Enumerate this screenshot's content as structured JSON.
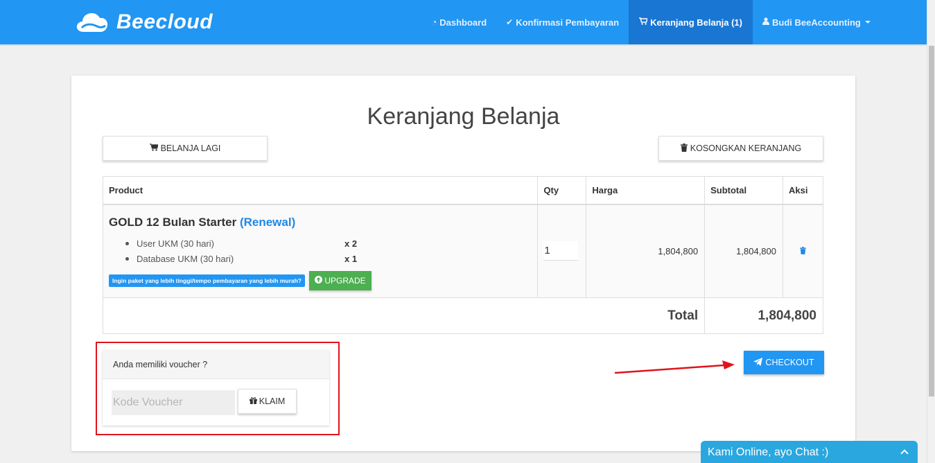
{
  "brand": {
    "name": "Beecloud"
  },
  "nav": {
    "items": [
      {
        "icon": "dashboard-icon",
        "label": "Dashboard"
      },
      {
        "icon": "check-icon",
        "label": "Konfirmasi Pembayaran"
      },
      {
        "icon": "cart-icon",
        "label": "Keranjang Belanja (1)",
        "active": true
      },
      {
        "icon": "user-icon",
        "label": "Budi BeeAccounting"
      }
    ]
  },
  "page": {
    "title": "Keranjang Belanja",
    "continue_label": "BELANJA LAGI",
    "empty_cart_label": "KOSONGKAN KERANJANG"
  },
  "table": {
    "headers": [
      "Product",
      "Qty",
      "Harga",
      "Subtotal",
      "Aksi"
    ],
    "rows": [
      {
        "name": "GOLD 12 Bulan Starter",
        "tag": "(Renewal)",
        "features": [
          {
            "label": "User UKM (30 hari)",
            "qty": "x 2"
          },
          {
            "label": "Database UKM (30 hari)",
            "qty": "x 1"
          }
        ],
        "upgrade_hint": "Ingin paket yang lebih tinggi/tempo pembayaran yang lebih murah?",
        "upgrade_label": "UPGRADE",
        "qty": "1",
        "harga": "1,804,800",
        "subtotal": "1,804,800"
      }
    ],
    "total_label": "Total",
    "total_value": "1,804,800"
  },
  "voucher": {
    "question": "Anda memiliki voucher ?",
    "placeholder": "Kode Voucher",
    "claim_label": "KLAIM"
  },
  "checkout": {
    "label": "CHECKOUT"
  },
  "chat": {
    "label": "Kami Online, ayo Chat :)"
  },
  "colors": {
    "primary": "#2196f3",
    "success": "#4caf50",
    "annotation": "#e0131c",
    "chat": "#2aa7df"
  }
}
